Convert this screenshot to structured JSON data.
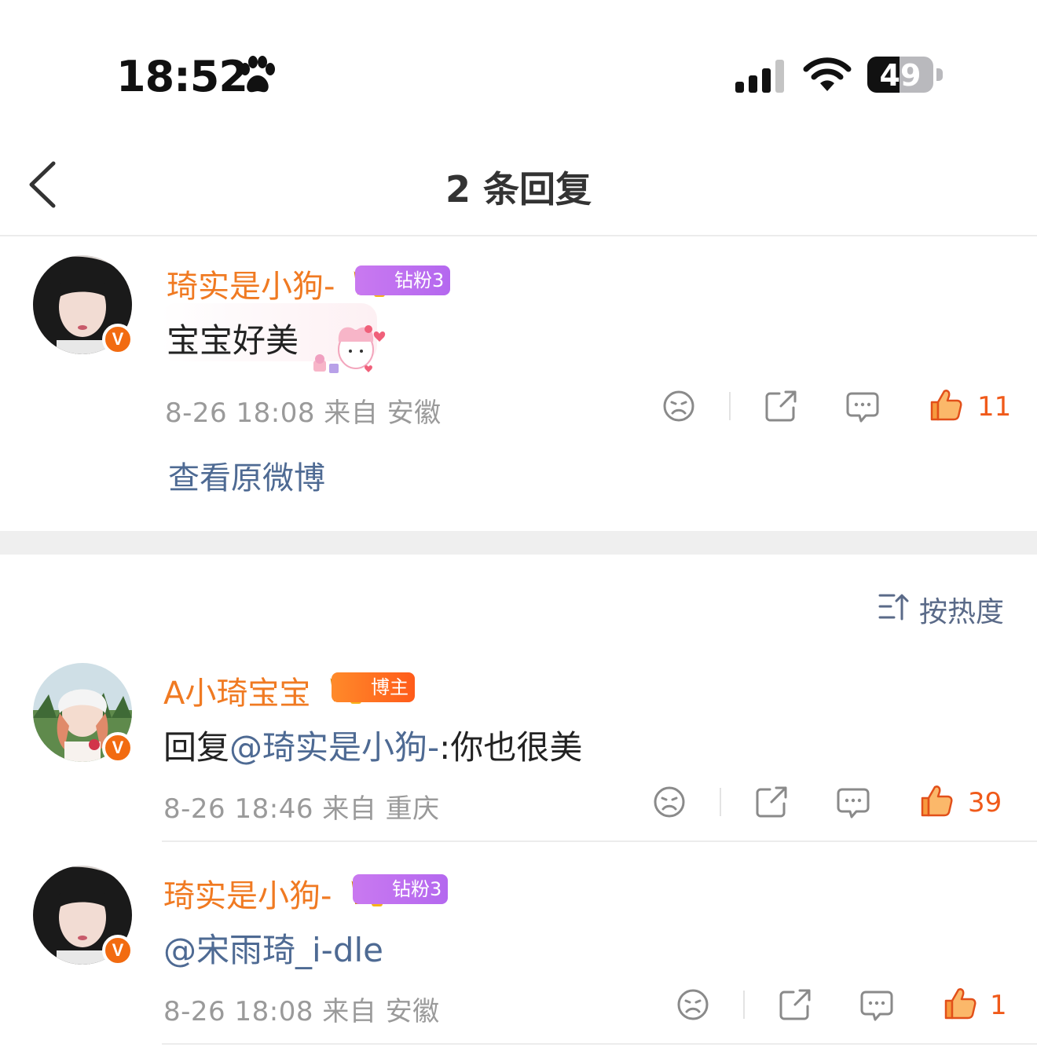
{
  "status_bar": {
    "time": "18:52",
    "battery": "49",
    "battery_level": 0.49
  },
  "nav": {
    "title": "2 条回复",
    "back_icon": "chevron-left-icon"
  },
  "root_comment": {
    "username": "琦实是小狗-",
    "badge": "钻粉3",
    "text": "宝宝好美",
    "time": "8-26 18:08",
    "source": "来自 安徽",
    "likes": "11",
    "view_original": "查看原微博"
  },
  "sort": {
    "label": "按热度",
    "icon": "sort-icon"
  },
  "replies": [
    {
      "username": "A小琦宝宝",
      "badge": "博主",
      "text_prefix": "回复",
      "mention": "@琦实是小狗-",
      "text_suffix": ":你也很美",
      "time": "8-26 18:46",
      "source": "来自 重庆",
      "likes": "39"
    },
    {
      "username": "琦实是小狗-",
      "badge": "钻粉3",
      "mention": "@宋雨琦_i-dle",
      "time": "8-26 18:08",
      "source": "来自 安徽",
      "likes": "1"
    }
  ],
  "colors": {
    "username": "#f07a22",
    "link": "#4e6a93",
    "like": "#f05a1a",
    "meta": "#9a9a9a",
    "fan_badge": "#c979f0",
    "host_badge": "#ff6a20"
  }
}
